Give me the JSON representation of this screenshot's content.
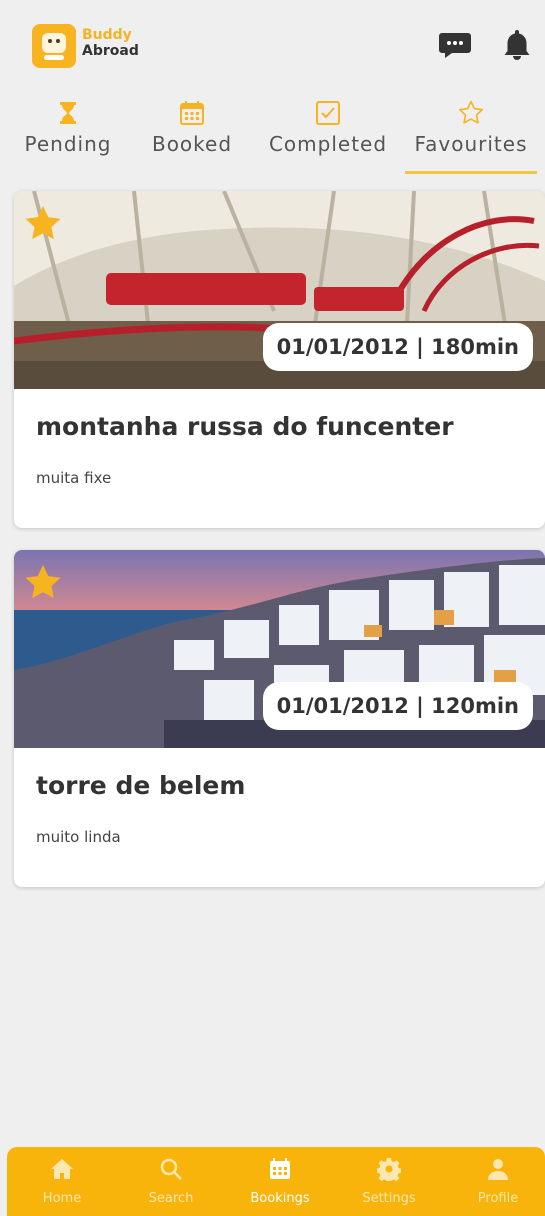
{
  "app": {
    "brand_line1": "Buddy",
    "brand_line2": "Abroad"
  },
  "header": {
    "icons": [
      "chat-icon",
      "bell-icon"
    ]
  },
  "tabs": [
    {
      "label": "Pending",
      "icon": "hourglass-icon",
      "active": false
    },
    {
      "label": "Booked",
      "icon": "calendar-icon",
      "active": false
    },
    {
      "label": "Completed",
      "icon": "checkbox-icon",
      "active": false
    },
    {
      "label": "Favourites",
      "icon": "star-outline-icon",
      "active": true
    }
  ],
  "cards": [
    {
      "date_duration": "01/01/2012 | 180min",
      "title": "montanha russa do funcenter",
      "description": "muita fixe",
      "favourite": true
    },
    {
      "date_duration": "01/01/2012 | 120min",
      "title": "torre de belem",
      "description": "muito linda",
      "favourite": true
    }
  ],
  "nav": [
    {
      "label": "Home",
      "icon": "home-icon",
      "active": false
    },
    {
      "label": "Search",
      "icon": "search-icon",
      "active": false
    },
    {
      "label": "Bookings",
      "icon": "calendar-icon",
      "active": true
    },
    {
      "label": "Settings",
      "icon": "gear-icon",
      "active": false
    },
    {
      "label": "Profile",
      "icon": "person-icon",
      "active": false
    }
  ],
  "colors": {
    "accent": "#f8b40a",
    "tab_indicator": "#f2c640",
    "background": "#efefef"
  }
}
